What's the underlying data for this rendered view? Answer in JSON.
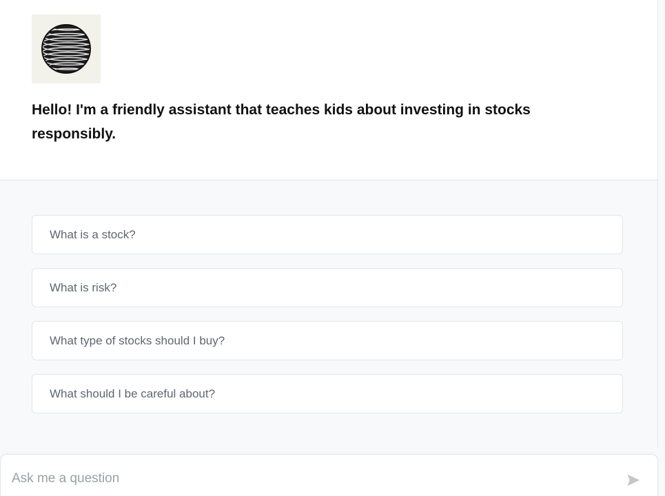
{
  "hero": {
    "avatar_icon": "striped-sphere-icon",
    "greeting": "Hello! I'm a friendly assistant that teaches kids about investing in stocks responsibly."
  },
  "suggestions": [
    {
      "label": "What is a stock?"
    },
    {
      "label": "What is risk?"
    },
    {
      "label": "What type of stocks should I buy?"
    },
    {
      "label": "What should I be careful about?"
    }
  ],
  "composer": {
    "placeholder": "Ask me a question",
    "send_icon": "send-icon"
  },
  "colors": {
    "panel_bg": "#f8f9fa",
    "card_border": "#e3e5e8",
    "suggestion_text": "#5f6670",
    "placeholder_text": "#9aa0a8"
  }
}
